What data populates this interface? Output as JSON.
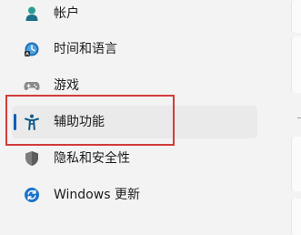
{
  "nav": {
    "items": [
      {
        "label": "帐户",
        "icon": "account-icon",
        "selected": false
      },
      {
        "label": "时间和语言",
        "icon": "time-language-icon",
        "selected": false
      },
      {
        "label": "游戏",
        "icon": "gaming-icon",
        "selected": false
      },
      {
        "label": "辅助功能",
        "icon": "accessibility-icon",
        "selected": true
      },
      {
        "label": "隐私和安全性",
        "icon": "privacy-shield-icon",
        "selected": false
      },
      {
        "label": "Windows 更新",
        "icon": "windows-update-icon",
        "selected": false
      }
    ]
  },
  "colors": {
    "accent": "#005fb8",
    "highlight_border": "#d33b3b",
    "background": "#f3f3f3",
    "selected_background": "#eaeaea"
  }
}
